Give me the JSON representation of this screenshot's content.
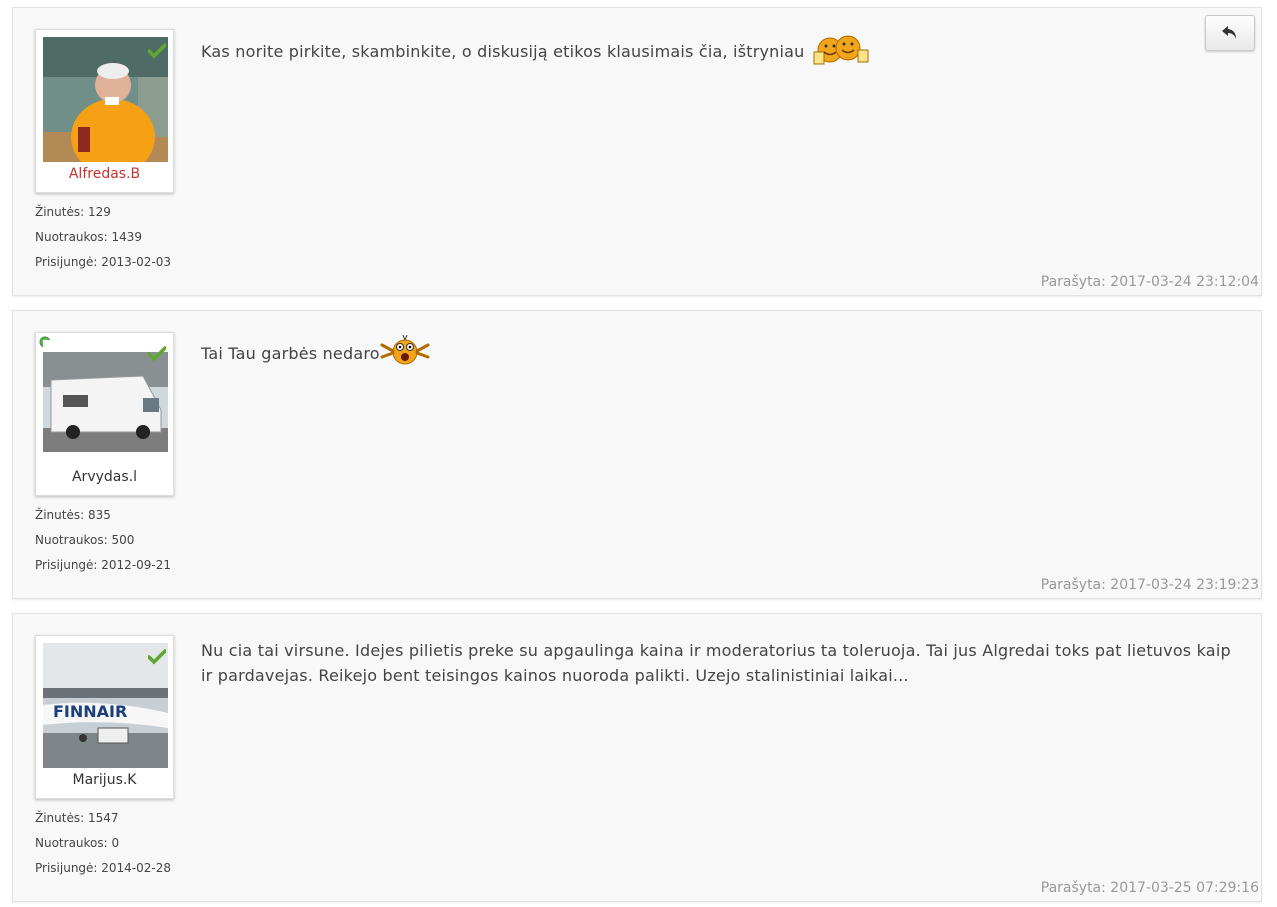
{
  "posts": [
    {
      "username": "Alfredas.B",
      "stats": {
        "messages": "Žinutės: 129",
        "photos": "Nuotraukos: 1439",
        "joined": "Prisijungė: 2013-02-03"
      },
      "message": "Kas norite pirkite, skambinkite, o diskusiją etikos klausimais čia, ištryniau",
      "emoji": "beer-cheers-emoji",
      "posted": "Parašyta: 2017-03-24 23:12:04"
    },
    {
      "username": "Arvydas.l",
      "stats": {
        "messages": "Žinutės: 835",
        "photos": "Nuotraukos: 500",
        "joined": "Prisijungė: 2012-09-21"
      },
      "message": "Tai Tau garbės nedaro",
      "emoji": "shocked-emoji",
      "posted": "Parašyta: 2017-03-24 23:19:23"
    },
    {
      "username": "Marijus.K",
      "stats": {
        "messages": "Žinutės: 1547",
        "photos": "Nuotraukos: 0",
        "joined": "Prisijungė: 2014-02-28"
      },
      "message": "Nu cia tai virsune. Idejes pilietis preke su apgaulinga kaina ir moderatorius ta toleruoja. Tai jus Algredai toks pat lietuvos kaip ir pardavejas. Reikejo bent teisingos kainos nuoroda palikti. Uzejo stalinistiniai laikai...",
      "posted": "Parašyta: 2017-03-25 07:29:16"
    }
  ],
  "icons": {
    "reply": "reply-arrow-icon",
    "verified": "check-icon",
    "online": "online-dot-icon"
  },
  "colors": {
    "admin_name": "#c8312d",
    "verified": "#5fa82f",
    "online": "#5cb85c"
  }
}
